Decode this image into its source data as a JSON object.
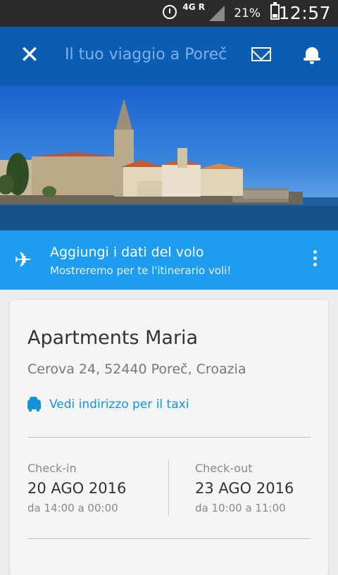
{
  "status": {
    "network": "4G",
    "roaming": "R",
    "battery": "21%",
    "time": "12:57"
  },
  "appbar": {
    "title": "Il tuo viaggio a Poreč"
  },
  "flight": {
    "title": "Aggiungi i dati del volo",
    "subtitle": "Mostreremo per te l'itinerario voli!"
  },
  "hotel": {
    "name": "Apartments Maria",
    "address": "Cerova 24, 52440 Poreč, Croazia",
    "taxi_link": "Vedi indirizzo per il taxi",
    "checkin": {
      "label": "Check-in",
      "date": "20 AGO 2016",
      "time": "da 14:00 a 00:00"
    },
    "checkout": {
      "label": "Check-out",
      "date": "23 AGO 2016",
      "time": "da 10:00 a 11:00"
    }
  },
  "colors": {
    "appbar": "#0b5cb3",
    "flight_banner": "#1e9cef",
    "link": "#1493dc"
  }
}
